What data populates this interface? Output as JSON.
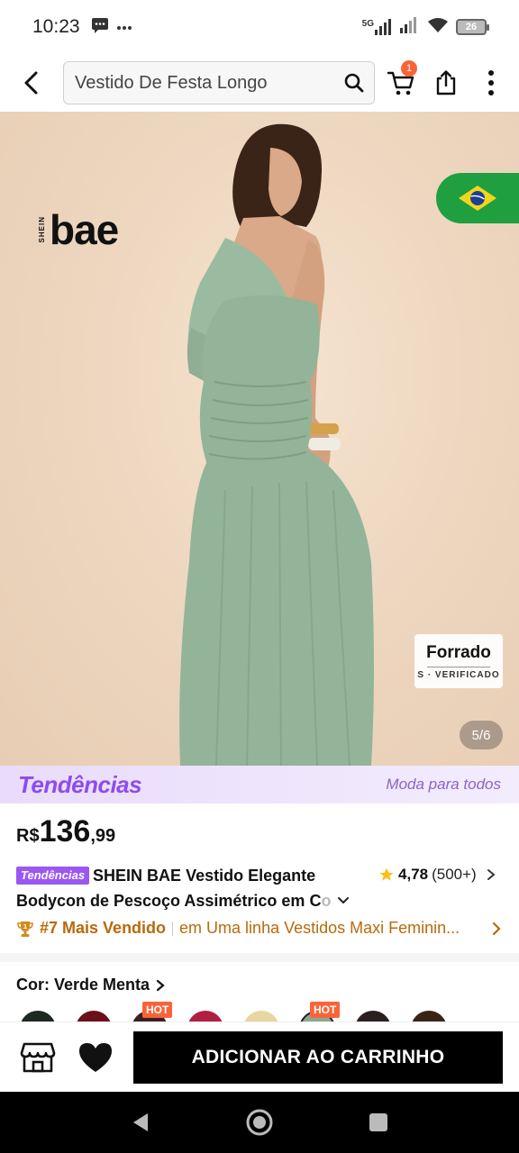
{
  "status_bar": {
    "time": "10:23",
    "network": "5G",
    "battery": "26"
  },
  "header": {
    "search_value": "Vestido De Festa Longo",
    "cart_count": "1",
    "icons": [
      "back-arrow-icon",
      "search-icon",
      "cart-icon",
      "share-icon",
      "more-vert-icon"
    ]
  },
  "product_image": {
    "brand_small": "SHEIN",
    "brand_main": "bae",
    "lined_title": "Forrado",
    "lined_sub": "S · VERIFICADO",
    "counter": "5/6",
    "flag": "Brazil"
  },
  "trends_banner": {
    "logo": "Tendências",
    "tagline": "Moda para todos"
  },
  "price": {
    "currency": "R$",
    "integer": "136",
    "decimal": ",99"
  },
  "product": {
    "tag": "Tendências",
    "title_line1": "SHEIN BAE Vestido Elegante",
    "title_line2": "Bodycon de Pescoço Assimétrico em C",
    "title_fade": "o",
    "rating": "4,78",
    "review_count": "(500+)"
  },
  "best_seller": {
    "rank": "#7 Mais Vendido",
    "category": "em Uma linha Vestidos Maxi Feminin..."
  },
  "color": {
    "label": "Cor: Verde Menta",
    "hot_label": "HOT",
    "swatches": [
      "#1c2a22",
      "#6b0f1a",
      "#3a2020",
      "#b02040",
      "#e8d6a0",
      "#8aa890",
      "#2a2020",
      "#3a2418"
    ]
  },
  "bottom_bar": {
    "add_to_cart": "ADICIONAR AO CARRINHO"
  },
  "colors": {
    "accent_orange": "#fa6338",
    "trends_purple": "#8c4cf0",
    "best_seller": "#b86a0a",
    "dress_green": "#93b498"
  }
}
